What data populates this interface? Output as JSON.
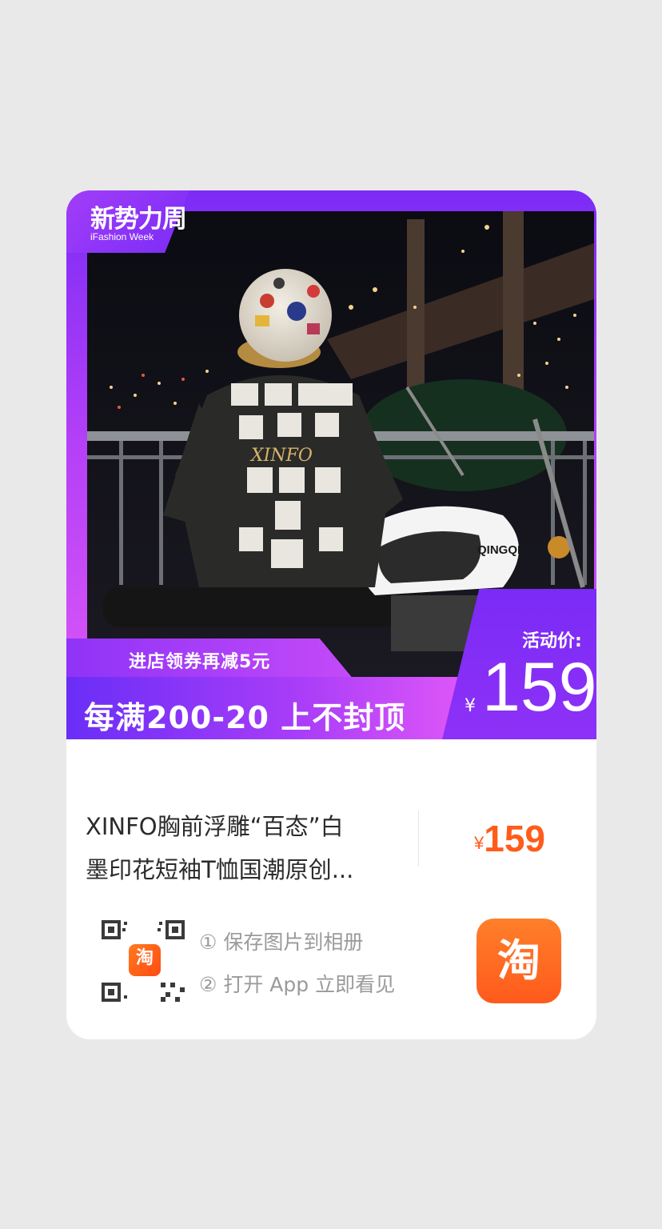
{
  "banner": {
    "brand_cn": "新势力周",
    "brand_en": "iFashion Week",
    "coupon_text": "进店领券再减5元",
    "promo_text": "每满200-20 上不封顶",
    "price_label": "活动价:",
    "currency": "¥",
    "price": "159",
    "photo_shirt_text": "XINFO",
    "photo_bike_text": "QINGQI"
  },
  "product": {
    "title_line1": "XINFO胸前浮雕“百态”白",
    "title_line2": "墨印花短袖T恤国潮原创...",
    "currency": "¥",
    "price": "159"
  },
  "share": {
    "qr_logo_text": "淘",
    "step1": "① 保存图片到相册",
    "step2": "② 打开 App 立即看见",
    "app_icon_text": "淘"
  },
  "colors": {
    "accent_purple": "#7c2cf6",
    "accent_pink": "#e05af7",
    "price_orange": "#ff5c1b",
    "taobao_orange": "#ff5a1c"
  }
}
